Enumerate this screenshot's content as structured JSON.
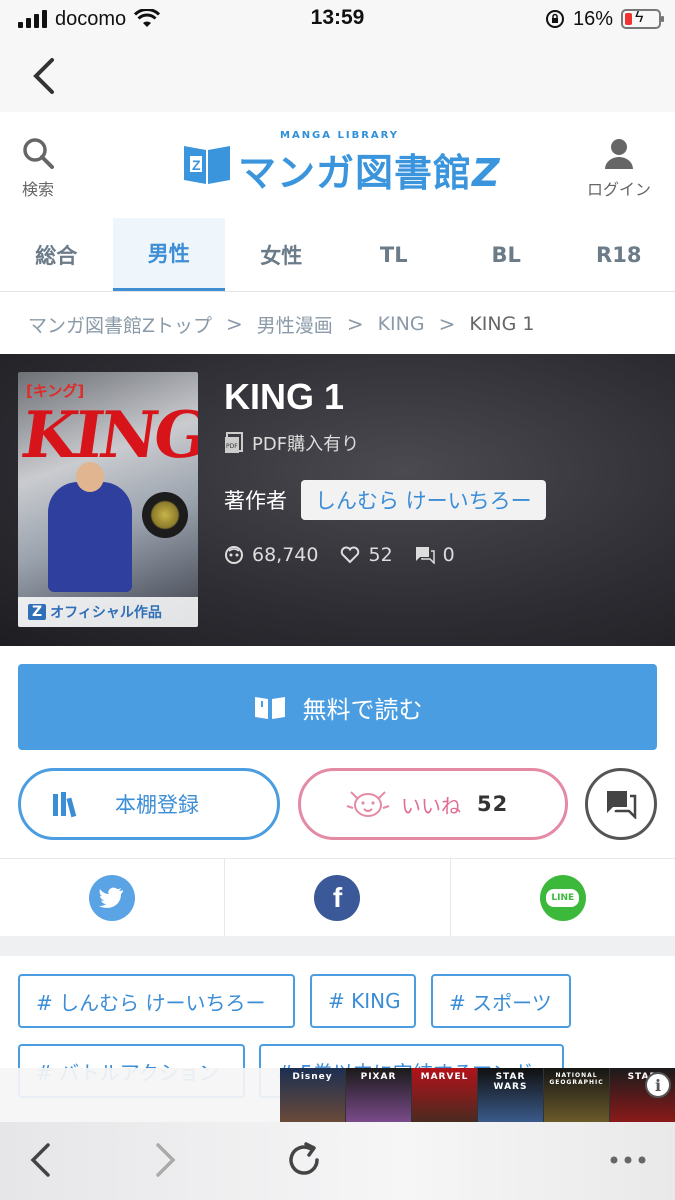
{
  "status_bar": {
    "carrier": "docomo",
    "time": "13:59",
    "battery": "16%"
  },
  "header": {
    "search_label": "検索",
    "login_label": "ログイン",
    "logo_sub": "MANGA LIBRARY",
    "logo_text": "マンガ図書館",
    "logo_z": "Z"
  },
  "tabs": [
    {
      "label": "総合",
      "active": false
    },
    {
      "label": "男性",
      "active": true
    },
    {
      "label": "女性",
      "active": false
    },
    {
      "label": "TL",
      "active": false
    },
    {
      "label": "BL",
      "active": false
    },
    {
      "label": "R18",
      "active": false
    }
  ],
  "breadcrumb": {
    "items": [
      "マンガ図書館Zトップ",
      "男性漫画",
      "KING",
      "KING 1"
    ],
    "separator": ">"
  },
  "book": {
    "title": "KING 1",
    "pdf_label": "PDF購入有り",
    "author_label": "著作者",
    "author_name": "しんむら けーいちろー",
    "views": "68,740",
    "likes": "52",
    "comments": "0",
    "cover": {
      "title_jp": "[キング]",
      "title_en": "KING",
      "badge_z": "Z",
      "badge_text": "オフィシャル作品"
    }
  },
  "actions": {
    "read_label": "無料で読む",
    "shelf_label": "本棚登録",
    "like_label": "いいね",
    "like_count": "52"
  },
  "share": {
    "twitter_icon": "twitter-icon",
    "facebook_icon": "facebook-icon",
    "facebook_glyph": "f",
    "line_icon": "line-icon",
    "line_glyph": "LINE",
    "colors": {
      "twitter": "#5aa4e6",
      "facebook": "#3b5998",
      "line": "#3cb93a"
    }
  },
  "tags": [
    "# しんむら けーいちろー",
    "# KING",
    "# スポーツ",
    "# バトルアクション",
    "# 5巻以内に完結するマンガ"
  ],
  "ad": {
    "brands": [
      "Disney",
      "PIXAR",
      "MARVEL",
      "STAR WARS",
      "NATIONAL GEOGRAPHIC",
      "STAR"
    ],
    "info_glyph": "i"
  },
  "colors": {
    "accent": "#4a9de0",
    "like": "#e58aa5"
  }
}
